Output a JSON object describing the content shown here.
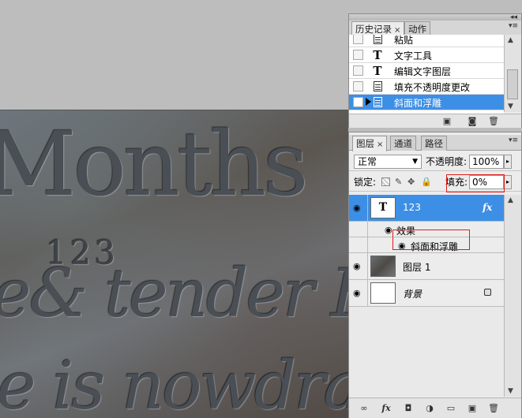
{
  "canvas": {
    "engraved_lines": [
      "Months",
      "123",
      "e& tender Hu",
      "e is nowdrawing"
    ]
  },
  "history_panel": {
    "tabs": [
      {
        "label": "历史记录",
        "close": "×"
      },
      {
        "label": "动作"
      }
    ],
    "states": [
      {
        "label": "粘贴",
        "icon": "document-icon"
      },
      {
        "label": "文字工具",
        "icon": "T"
      },
      {
        "label": "编辑文字图层",
        "icon": "T"
      },
      {
        "label": "填充不透明度更改",
        "icon": "document-icon"
      },
      {
        "label": "斜面和浮雕",
        "icon": "document-icon",
        "selected": true
      }
    ],
    "footer": [
      "new-document-from-state-icon",
      "camera-icon",
      "trash-icon"
    ]
  },
  "layers_panel": {
    "tabs": [
      {
        "label": "图层",
        "close": "×"
      },
      {
        "label": "通道"
      },
      {
        "label": "路径"
      }
    ],
    "blend_mode": "正常",
    "opacity_label": "不透明度:",
    "opacity_value": "100%",
    "lock_label": "锁定:",
    "fill_label": "填充:",
    "fill_value": "0%",
    "layers": [
      {
        "name": "123",
        "type": "text",
        "thumb": "T",
        "selected": true,
        "fx": "fx"
      },
      {
        "name": "图层 1",
        "type": "photo"
      },
      {
        "name": "背景",
        "type": "background",
        "locked": true
      }
    ],
    "effects_label": "效果",
    "effect_items": [
      "斜面和浮雕"
    ]
  },
  "colors": {
    "selection": "#3d8fe5",
    "highlight_box": "#e01b1b",
    "panel_bg": "#ececec"
  }
}
